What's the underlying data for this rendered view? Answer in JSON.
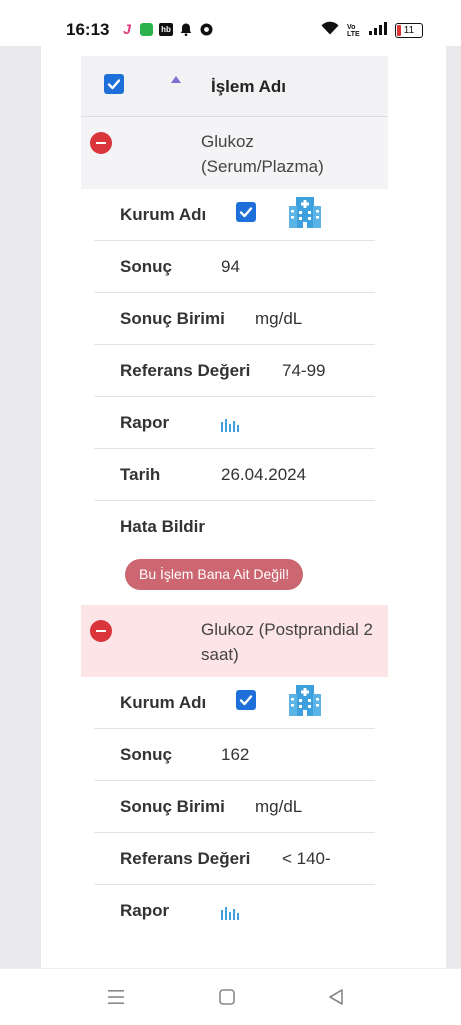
{
  "status_bar": {
    "time": "16:13",
    "battery": "11",
    "left_icons": [
      "notification-j-icon",
      "chat-icon",
      "hb-icon",
      "bell-icon",
      "chrome-icon"
    ],
    "right_icons": [
      "wifi-icon",
      "volte-icon",
      "signal-icon",
      "battery-icon"
    ],
    "volte_text": "Vo LTE",
    "hb_text": "hb"
  },
  "table": {
    "header_label": "İşlem Adı"
  },
  "records": [
    {
      "name": "Glukoz (Serum/Plazma)",
      "row_bg": "gray",
      "fields": {
        "institution_label": "Kurum Adı",
        "result_label": "Sonuç",
        "result_value": "94",
        "unit_label": "Sonuç Birimi",
        "unit_value": "mg/dL",
        "ref_label": "Referans Değeri",
        "ref_value": "74-99",
        "report_label": "Rapor",
        "date_label": "Tarih",
        "date_value": "26.04.2024",
        "error_label": "Hata Bildir",
        "error_button": "Bu İşlem Bana Ait Değil!"
      }
    },
    {
      "name": "Glukoz (Postprandial 2 saat)",
      "row_bg": "pink",
      "fields": {
        "institution_label": "Kurum Adı",
        "result_label": "Sonuç",
        "result_value": "162",
        "unit_label": "Sonuç Birimi",
        "unit_value": "mg/dL",
        "ref_label": "Referans Değeri",
        "ref_value": "< 140-",
        "report_label": "Rapor"
      }
    }
  ],
  "colors": {
    "accent_blue": "#1e6fd9",
    "danger_red": "#d9353b",
    "error_button": "#cc6670",
    "pink_row": "#fde4e6",
    "gray_row": "#f4f4f6",
    "hospital_icon": "#3ea0dc"
  },
  "nav_bar": {
    "icons": [
      "menu-icon",
      "home-icon",
      "back-icon"
    ]
  }
}
